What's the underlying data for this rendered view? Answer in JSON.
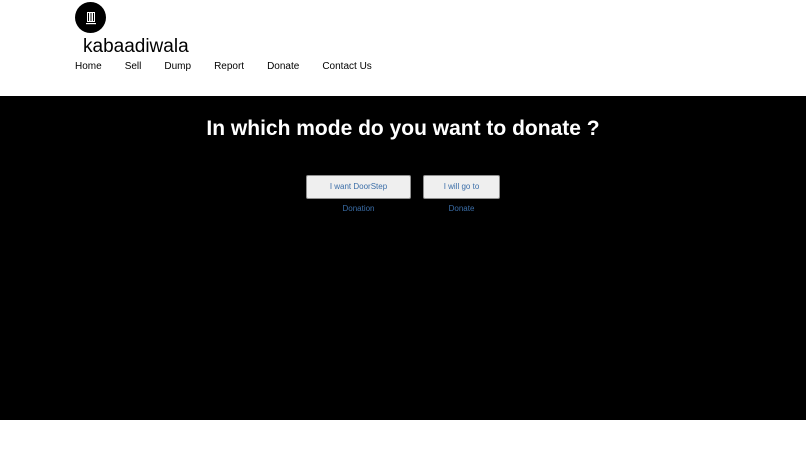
{
  "brand": {
    "logo_icon": "recycle-bin-logo-icon",
    "name": "kabaadiwala"
  },
  "nav": {
    "items": [
      {
        "label": "Home"
      },
      {
        "label": "Sell"
      },
      {
        "label": "Dump"
      },
      {
        "label": "Report"
      },
      {
        "label": "Donate"
      },
      {
        "label": "Contact Us"
      }
    ]
  },
  "hero": {
    "title": "In which mode do you want to donate ?",
    "buttons": {
      "doorstep_label": "I want DoorStep Donation",
      "self_label": "I will go to Donate"
    }
  },
  "colors": {
    "hero_background": "#000000",
    "button_text": "#3b6ea8",
    "button_background": "#efefef"
  }
}
